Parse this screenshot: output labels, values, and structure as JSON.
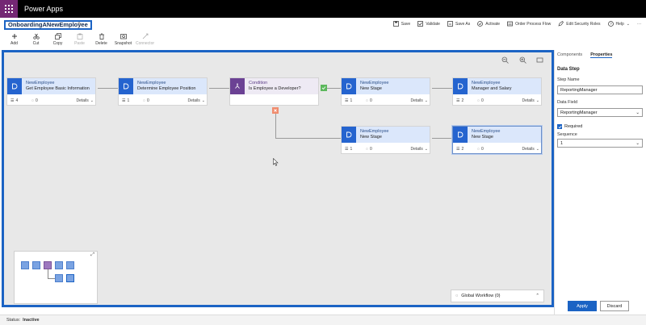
{
  "app": {
    "title": "Power Apps"
  },
  "process": {
    "name": "OnboardingANewEmployee"
  },
  "commands": [
    {
      "label": "Save",
      "icon": "save-icon"
    },
    {
      "label": "Validate",
      "icon": "validate-icon"
    },
    {
      "label": "Save As",
      "icon": "save-as-icon"
    },
    {
      "label": "Activate",
      "icon": "activate-icon"
    },
    {
      "label": "Order Process Flow",
      "icon": "order-icon"
    },
    {
      "label": "Edit Security Roles",
      "icon": "security-icon"
    },
    {
      "label": "Help",
      "icon": "help-icon"
    }
  ],
  "tools": [
    {
      "label": "Add",
      "icon": "plus-icon",
      "enabled": true
    },
    {
      "label": "Cut",
      "icon": "scissors-icon",
      "enabled": true
    },
    {
      "label": "Copy",
      "icon": "copy-icon",
      "enabled": true
    },
    {
      "label": "Paste",
      "icon": "paste-icon",
      "enabled": false
    },
    {
      "label": "Delete",
      "icon": "trash-icon",
      "enabled": true
    },
    {
      "label": "Snapshot",
      "icon": "snapshot-icon",
      "enabled": true
    },
    {
      "label": "Connector",
      "icon": "connector-icon",
      "enabled": false
    }
  ],
  "stages": [
    {
      "entity": "NewEmployee",
      "name": "Get Employee Basic Information",
      "steps": "4",
      "conditions": "0",
      "details": "Details"
    },
    {
      "entity": "NewEmployee",
      "name": "Determine Employee Position",
      "steps": "1",
      "conditions": "0",
      "details": "Details"
    },
    {
      "entity": "NewEmployee",
      "name": "New Stage",
      "steps": "1",
      "conditions": "0",
      "details": "Details"
    },
    {
      "entity": "NewEmployee",
      "name": "Manager and Salary",
      "steps": "2",
      "conditions": "0",
      "details": "Details"
    },
    {
      "entity": "NewEmployee",
      "name": "New Stage",
      "steps": "1",
      "conditions": "0",
      "details": "Details"
    },
    {
      "entity": "NewEmployee",
      "name": "New Stage",
      "steps": "2",
      "conditions": "0",
      "details": "Details"
    }
  ],
  "condition": {
    "title": "Condition",
    "text": "Is Employee a Developer?"
  },
  "global_workflow": {
    "label": "Global Workflow (0)"
  },
  "panel": {
    "tabs": [
      "Components",
      "Properties"
    ],
    "active_tab": "Properties",
    "section": "Data Step",
    "step_name_label": "Step Name",
    "step_name_value": "ReportingManager",
    "data_field_label": "Data Field",
    "data_field_value": "ReportingManager",
    "required_label": "Required",
    "required_checked": true,
    "sequence_label": "Sequence",
    "sequence_value": "1",
    "apply_label": "Apply",
    "discard_label": "Discard"
  },
  "status": {
    "label": "Status:",
    "value": "Inactive"
  },
  "colors": {
    "accent": "#1b63c4",
    "brand": "#742774",
    "stage_icon": "#2564cf",
    "condition_icon": "#6b4194",
    "yes": "#5cb85c",
    "no": "#f08c6e"
  }
}
